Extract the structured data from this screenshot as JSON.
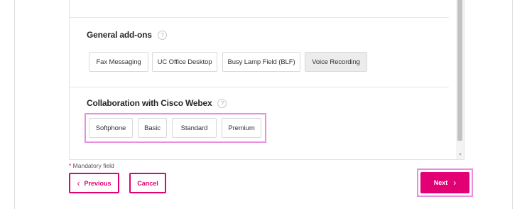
{
  "general_addons": {
    "title": "General add-ons",
    "help": "?",
    "options": [
      {
        "label": "Fax Messaging",
        "selected": false
      },
      {
        "label": "UC Office Desktop",
        "selected": false
      },
      {
        "label": "Busy Lamp Field (BLF)",
        "selected": false
      },
      {
        "label": "Voice Recording",
        "selected": true
      }
    ]
  },
  "collaboration": {
    "title": "Collaboration with Cisco Webex",
    "help": "?",
    "options": [
      {
        "label": "Softphone"
      },
      {
        "label": "Basic"
      },
      {
        "label": "Standard"
      },
      {
        "label": "Premium"
      }
    ]
  },
  "footer": {
    "mandatory_star": "*",
    "mandatory_text": " Mandatory field",
    "previous_icon": "‹",
    "previous_label": "Previous",
    "cancel_label": "Cancel",
    "next_label": "Next",
    "next_icon": "›"
  },
  "icons": {
    "help": "help-circle-icon",
    "previous": "chevron-left-icon",
    "next": "chevron-right-icon",
    "scroll_down": "triangle-down-icon"
  },
  "colors": {
    "brand": "#e20074",
    "highlight": "#ea8fe0"
  }
}
